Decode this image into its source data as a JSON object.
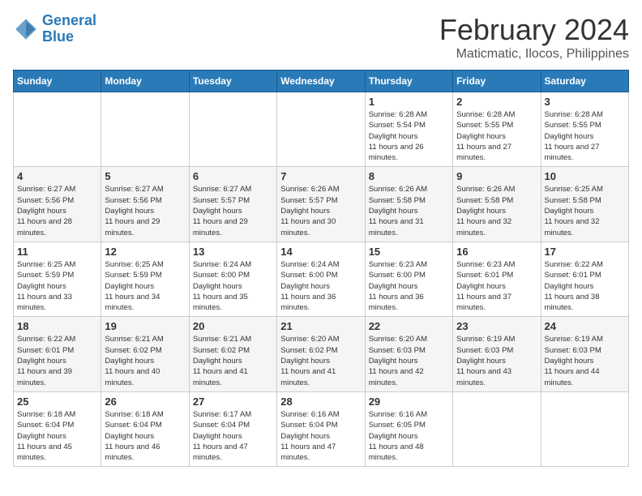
{
  "logo": {
    "line1": "General",
    "line2": "Blue"
  },
  "title": "February 2024",
  "location": "Maticmatic, Ilocos, Philippines",
  "weekdays": [
    "Sunday",
    "Monday",
    "Tuesday",
    "Wednesday",
    "Thursday",
    "Friday",
    "Saturday"
  ],
  "weeks": [
    [
      {
        "day": "",
        "sunrise": "",
        "sunset": "",
        "daylight": ""
      },
      {
        "day": "",
        "sunrise": "",
        "sunset": "",
        "daylight": ""
      },
      {
        "day": "",
        "sunrise": "",
        "sunset": "",
        "daylight": ""
      },
      {
        "day": "",
        "sunrise": "",
        "sunset": "",
        "daylight": ""
      },
      {
        "day": "1",
        "sunrise": "6:28 AM",
        "sunset": "5:54 PM",
        "daylight": "11 hours and 26 minutes."
      },
      {
        "day": "2",
        "sunrise": "6:28 AM",
        "sunset": "5:55 PM",
        "daylight": "11 hours and 27 minutes."
      },
      {
        "day": "3",
        "sunrise": "6:28 AM",
        "sunset": "5:55 PM",
        "daylight": "11 hours and 27 minutes."
      }
    ],
    [
      {
        "day": "4",
        "sunrise": "6:27 AM",
        "sunset": "5:56 PM",
        "daylight": "11 hours and 28 minutes."
      },
      {
        "day": "5",
        "sunrise": "6:27 AM",
        "sunset": "5:56 PM",
        "daylight": "11 hours and 29 minutes."
      },
      {
        "day": "6",
        "sunrise": "6:27 AM",
        "sunset": "5:57 PM",
        "daylight": "11 hours and 29 minutes."
      },
      {
        "day": "7",
        "sunrise": "6:26 AM",
        "sunset": "5:57 PM",
        "daylight": "11 hours and 30 minutes."
      },
      {
        "day": "8",
        "sunrise": "6:26 AM",
        "sunset": "5:58 PM",
        "daylight": "11 hours and 31 minutes."
      },
      {
        "day": "9",
        "sunrise": "6:26 AM",
        "sunset": "5:58 PM",
        "daylight": "11 hours and 32 minutes."
      },
      {
        "day": "10",
        "sunrise": "6:25 AM",
        "sunset": "5:58 PM",
        "daylight": "11 hours and 32 minutes."
      }
    ],
    [
      {
        "day": "11",
        "sunrise": "6:25 AM",
        "sunset": "5:59 PM",
        "daylight": "11 hours and 33 minutes."
      },
      {
        "day": "12",
        "sunrise": "6:25 AM",
        "sunset": "5:59 PM",
        "daylight": "11 hours and 34 minutes."
      },
      {
        "day": "13",
        "sunrise": "6:24 AM",
        "sunset": "6:00 PM",
        "daylight": "11 hours and 35 minutes."
      },
      {
        "day": "14",
        "sunrise": "6:24 AM",
        "sunset": "6:00 PM",
        "daylight": "11 hours and 36 minutes."
      },
      {
        "day": "15",
        "sunrise": "6:23 AM",
        "sunset": "6:00 PM",
        "daylight": "11 hours and 36 minutes."
      },
      {
        "day": "16",
        "sunrise": "6:23 AM",
        "sunset": "6:01 PM",
        "daylight": "11 hours and 37 minutes."
      },
      {
        "day": "17",
        "sunrise": "6:22 AM",
        "sunset": "6:01 PM",
        "daylight": "11 hours and 38 minutes."
      }
    ],
    [
      {
        "day": "18",
        "sunrise": "6:22 AM",
        "sunset": "6:01 PM",
        "daylight": "11 hours and 39 minutes."
      },
      {
        "day": "19",
        "sunrise": "6:21 AM",
        "sunset": "6:02 PM",
        "daylight": "11 hours and 40 minutes."
      },
      {
        "day": "20",
        "sunrise": "6:21 AM",
        "sunset": "6:02 PM",
        "daylight": "11 hours and 41 minutes."
      },
      {
        "day": "21",
        "sunrise": "6:20 AM",
        "sunset": "6:02 PM",
        "daylight": "11 hours and 41 minutes."
      },
      {
        "day": "22",
        "sunrise": "6:20 AM",
        "sunset": "6:03 PM",
        "daylight": "11 hours and 42 minutes."
      },
      {
        "day": "23",
        "sunrise": "6:19 AM",
        "sunset": "6:03 PM",
        "daylight": "11 hours and 43 minutes."
      },
      {
        "day": "24",
        "sunrise": "6:19 AM",
        "sunset": "6:03 PM",
        "daylight": "11 hours and 44 minutes."
      }
    ],
    [
      {
        "day": "25",
        "sunrise": "6:18 AM",
        "sunset": "6:04 PM",
        "daylight": "11 hours and 45 minutes."
      },
      {
        "day": "26",
        "sunrise": "6:18 AM",
        "sunset": "6:04 PM",
        "daylight": "11 hours and 46 minutes."
      },
      {
        "day": "27",
        "sunrise": "6:17 AM",
        "sunset": "6:04 PM",
        "daylight": "11 hours and 47 minutes."
      },
      {
        "day": "28",
        "sunrise": "6:16 AM",
        "sunset": "6:04 PM",
        "daylight": "11 hours and 47 minutes."
      },
      {
        "day": "29",
        "sunrise": "6:16 AM",
        "sunset": "6:05 PM",
        "daylight": "11 hours and 48 minutes."
      },
      {
        "day": "",
        "sunrise": "",
        "sunset": "",
        "daylight": ""
      },
      {
        "day": "",
        "sunrise": "",
        "sunset": "",
        "daylight": ""
      }
    ]
  ]
}
